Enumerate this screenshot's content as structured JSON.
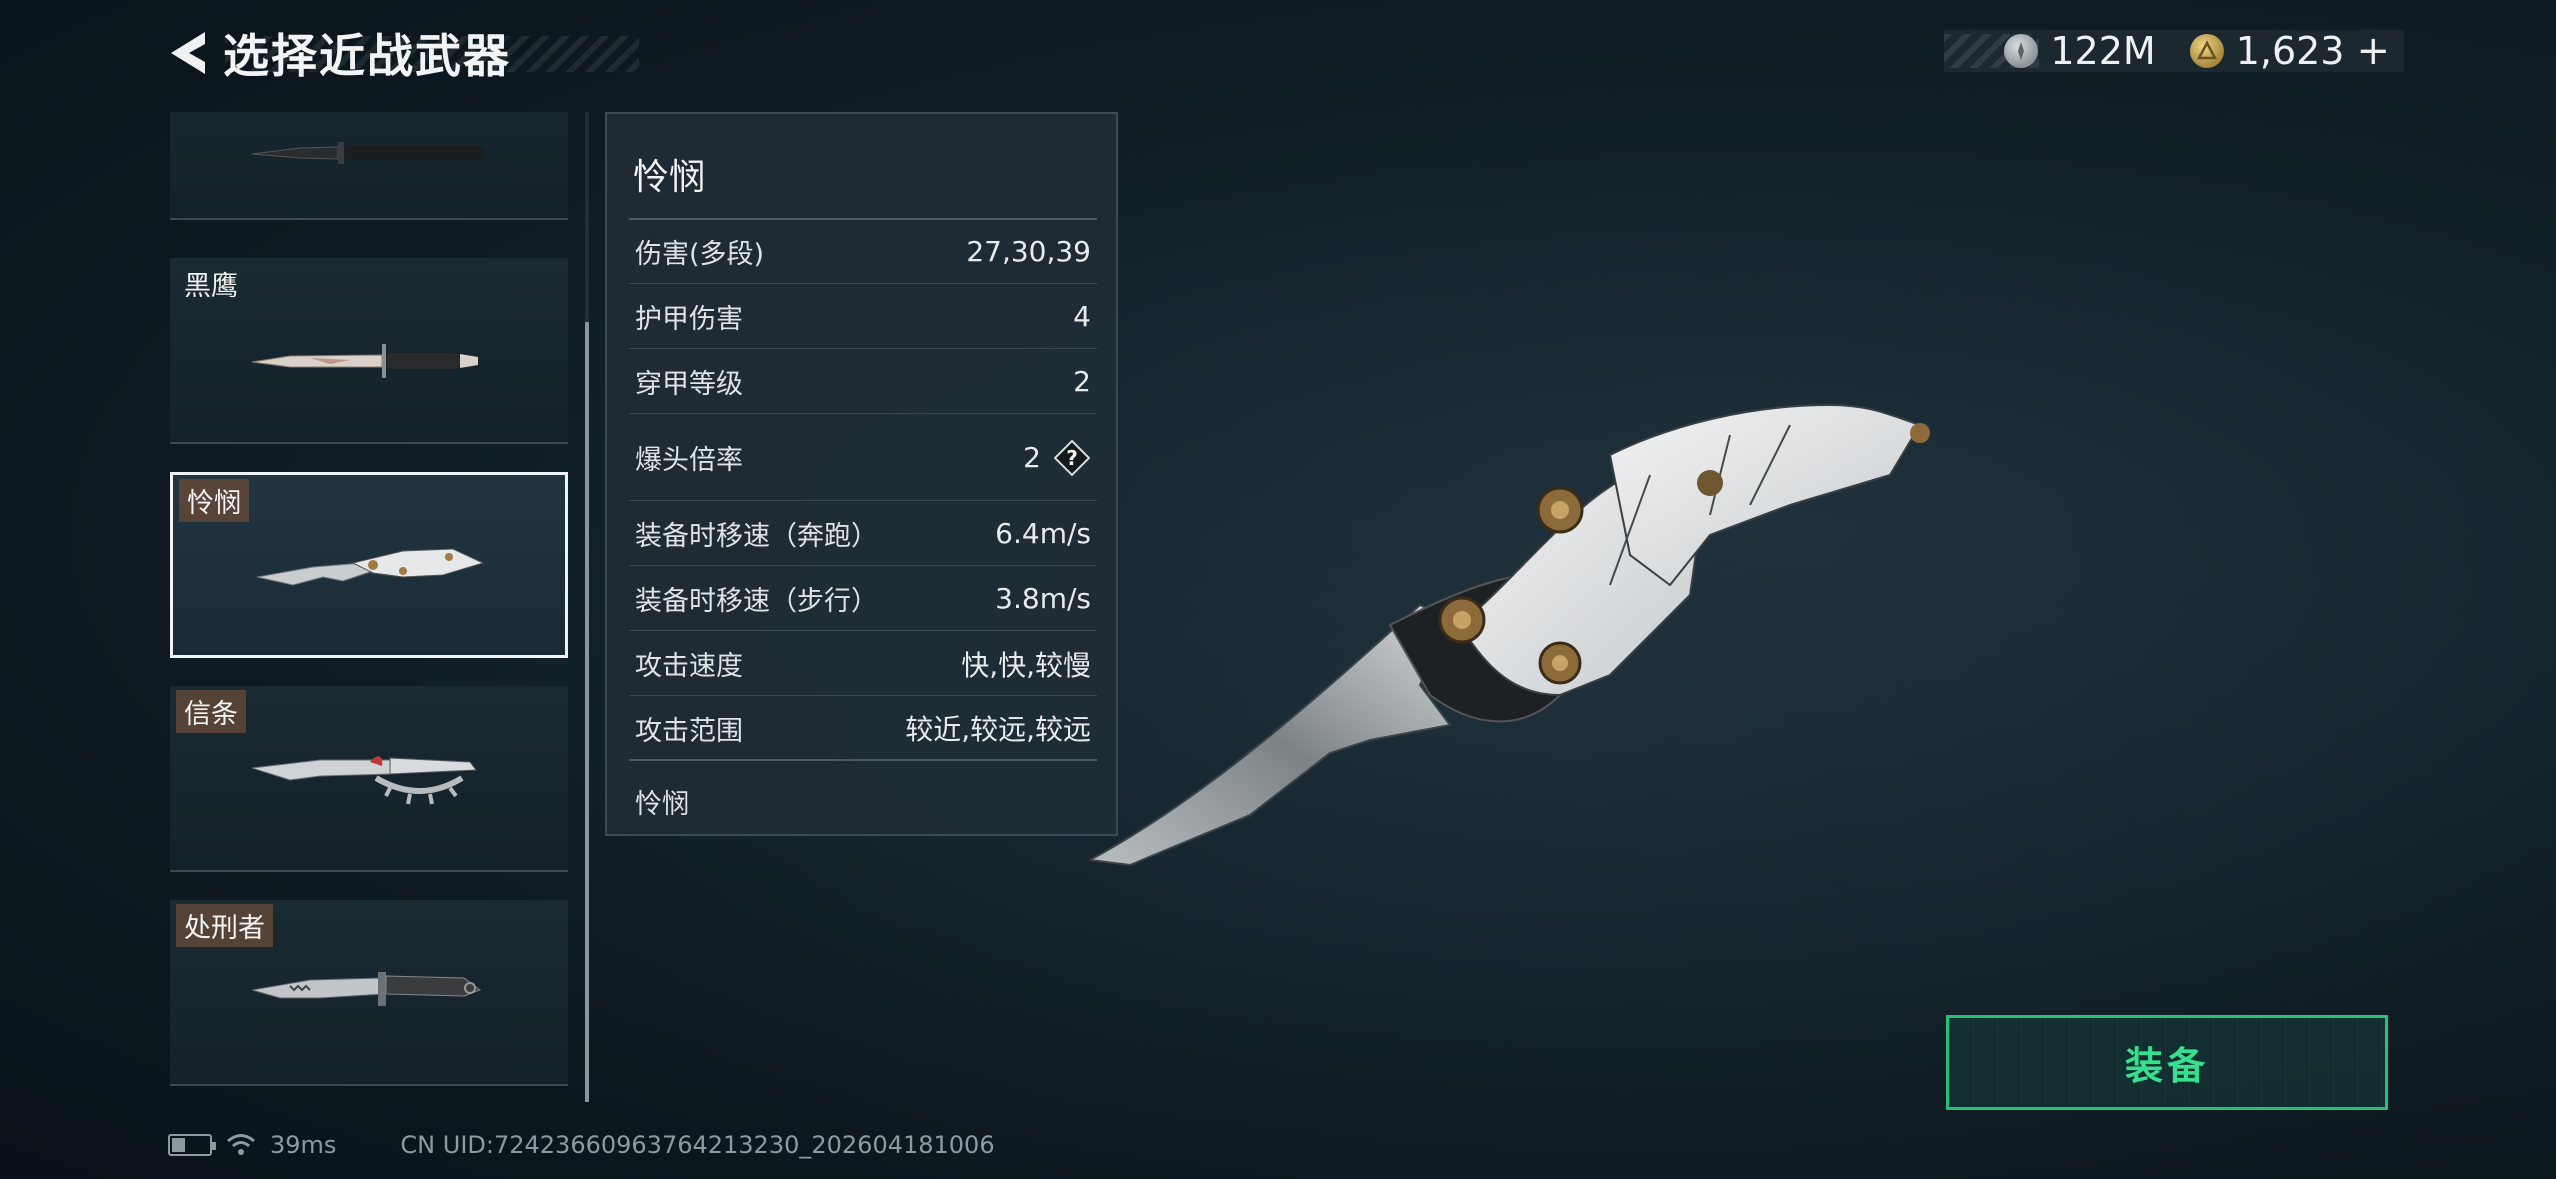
{
  "header": {
    "title": "选择近战武器"
  },
  "currency": {
    "silver_value": "122M",
    "gold_value": "1,623",
    "add_symbol": "+"
  },
  "weapon_list": {
    "items": [
      {
        "label": ""
      },
      {
        "label": "黑鹰"
      },
      {
        "label": "怜悯",
        "selected": true
      },
      {
        "label": "信条"
      },
      {
        "label": "处刑者"
      }
    ]
  },
  "stats": {
    "weapon_name": "怜悯",
    "rows": [
      {
        "label": "伤害(多段)",
        "value": "27,30,39"
      },
      {
        "label": "护甲伤害",
        "value": "4"
      },
      {
        "label": "穿甲等级",
        "value": "2"
      },
      {
        "label": "爆头倍率",
        "value": "2"
      },
      {
        "label": "装备时移速（奔跑）",
        "value": "6.4m/s"
      },
      {
        "label": "装备时移速（步行）",
        "value": "3.8m/s"
      },
      {
        "label": "攻击速度",
        "value": "快,快,较慢"
      },
      {
        "label": "攻击范围",
        "value": "较近,较远,较远"
      }
    ],
    "footer": "怜悯",
    "help_symbol": "?"
  },
  "equip_button": {
    "label": "装备"
  },
  "status_bar": {
    "battery_level": 0.35,
    "ping": "39ms",
    "uid": "CN UID:7242366096376421323​0_202604181006"
  },
  "colors": {
    "accent_green": "#36e08e",
    "selected_border": "#f0f2f3",
    "label_bg": "#624838"
  }
}
